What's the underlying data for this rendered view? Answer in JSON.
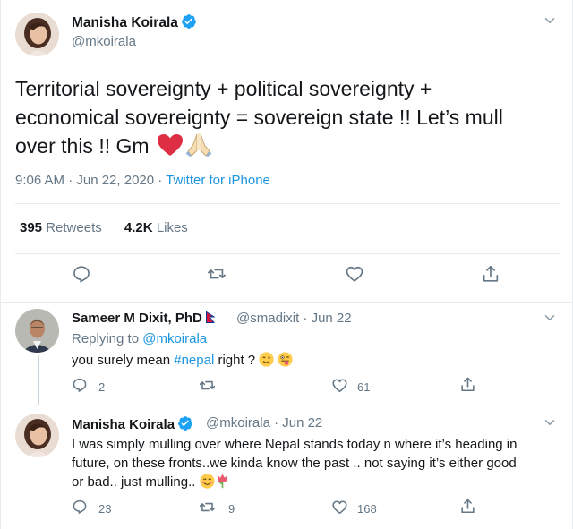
{
  "main_tweet": {
    "author_name": "Manisha Koirala",
    "author_handle": "@mkoirala",
    "text_line1": "Territorial sovereignty + political sovereignty +",
    "text_line2": "economical sovereignty = sovereign state !! Let’s mull",
    "text_line3": "over this !! Gm",
    "time": "9:06 AM · Jun 22, 2020 · ",
    "source": "Twitter for iPhone",
    "retweet_count": "395",
    "retweet_label": "Retweets",
    "like_count": "4.2K",
    "like_label": "Likes"
  },
  "replies": [
    {
      "author_name": "Sameer M Dixit, PhD",
      "author_handle": "@smadixit · Jun 22",
      "replying_prefix": "Replying to ",
      "replying_to": "@mkoirala",
      "text_before": "you surely mean ",
      "hashtag": "#nepal",
      "text_after": " right ?",
      "reply_count": "2",
      "retweet_count": "",
      "like_count": "61"
    },
    {
      "author_name": "Manisha Koirala",
      "author_handle": "@mkoirala · Jun 22",
      "text_line1": "I was simply mulling over where Nepal stands today n where it’s heading in",
      "text_line2": "future, on these fronts..we kinda know the past .. not saying it’s either good",
      "text_line3": "or bad.. just mulling..",
      "reply_count": "23",
      "retweet_count": "9",
      "like_count": "168"
    }
  ],
  "colors": {
    "accent": "#1b95e0",
    "muted": "#657786",
    "border": "#e6ecf0",
    "text": "#14171a"
  },
  "icons": [
    "verified-badge-icon",
    "chevron-down-icon",
    "reply-icon",
    "retweet-icon",
    "like-icon",
    "share-icon",
    "nepal-flag-icon",
    "heart-emoji-icon",
    "folded-hands-emoji-icon",
    "wink-emoji-icon",
    "tongue-emoji-icon",
    "smile-emoji-icon",
    "tulip-emoji-icon"
  ]
}
